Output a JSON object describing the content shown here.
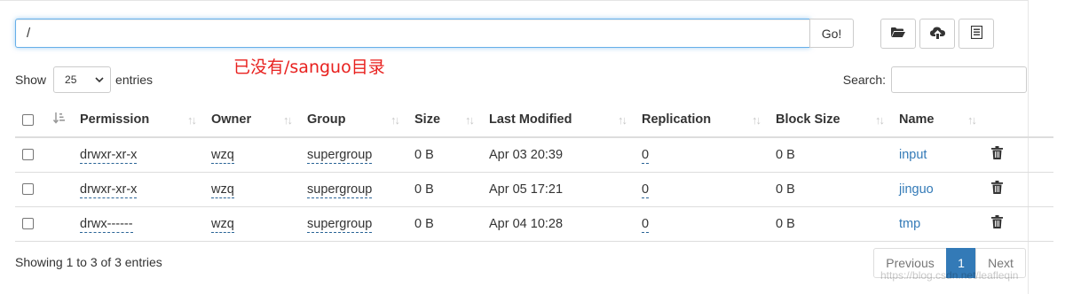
{
  "path_bar": {
    "value": "/",
    "go_label": "Go!"
  },
  "toolbar": {
    "icons": [
      "folder-open-icon",
      "cloud-upload-icon",
      "list-icon"
    ]
  },
  "annotation": "已没有/sanguo目录",
  "length": {
    "show_label": "Show",
    "selected": "25",
    "entries_label": "entries"
  },
  "search": {
    "label": "Search:",
    "value": ""
  },
  "table": {
    "columns": [
      "Permission",
      "Owner",
      "Group",
      "Size",
      "Last Modified",
      "Replication",
      "Block Size",
      "Name"
    ],
    "rows": [
      {
        "permission": "drwxr-xr-x",
        "owner": "wzq",
        "group": "supergroup",
        "size": "0 B",
        "last_modified": "Apr 03 20:39",
        "replication": "0",
        "block_size": "0 B",
        "name": "input"
      },
      {
        "permission": "drwxr-xr-x",
        "owner": "wzq",
        "group": "supergroup",
        "size": "0 B",
        "last_modified": "Apr 05 17:21",
        "replication": "0",
        "block_size": "0 B",
        "name": "jinguo"
      },
      {
        "permission": "drwx------",
        "owner": "wzq",
        "group": "supergroup",
        "size": "0 B",
        "last_modified": "Apr 04 10:28",
        "replication": "0",
        "block_size": "0 B",
        "name": "tmp"
      }
    ]
  },
  "info": "Showing 1 to 3 of 3 entries",
  "pagination": {
    "previous": "Previous",
    "current": "1",
    "next": "Next"
  },
  "watermark": "https://blog.csdn.net/leafleqin",
  "colors": {
    "accent": "#337ab7",
    "annotation": "#e8201e",
    "focus": "#66afe9"
  }
}
